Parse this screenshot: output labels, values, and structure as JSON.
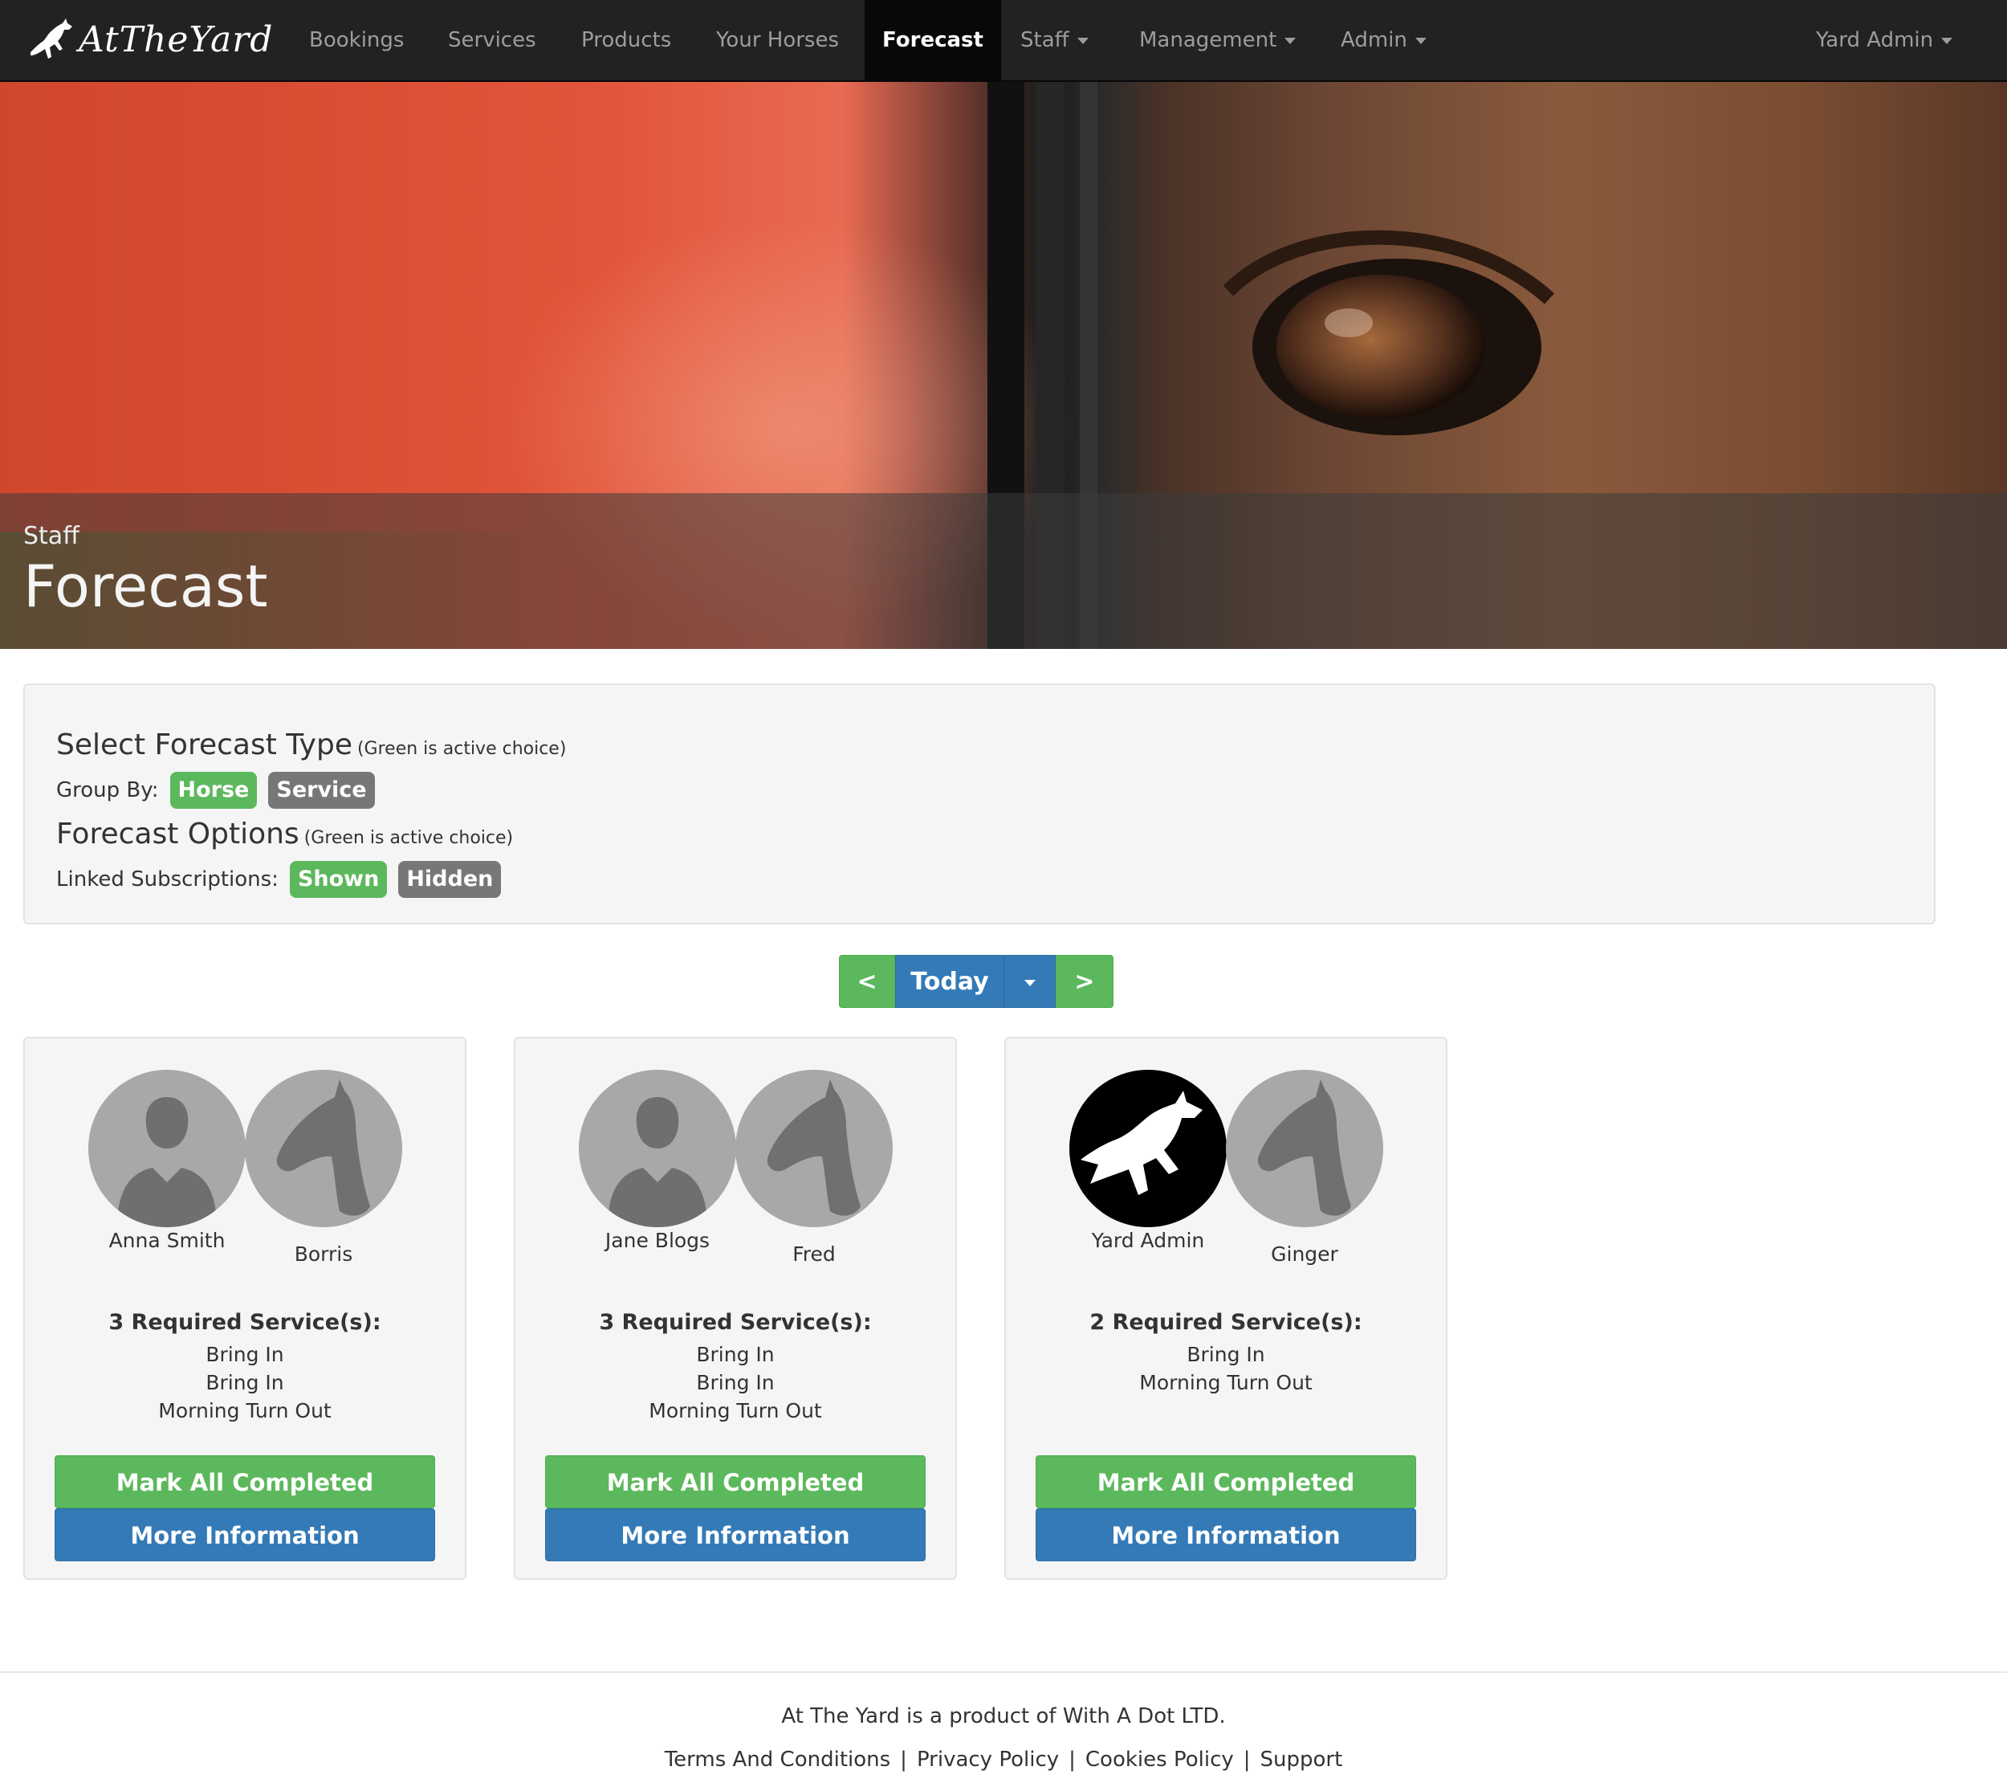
{
  "nav": {
    "brand": "AtTheYard",
    "items": [
      {
        "label": "Bookings"
      },
      {
        "label": "Services"
      },
      {
        "label": "Products"
      },
      {
        "label": "Your Horses"
      },
      {
        "label": "Forecast"
      },
      {
        "label": "Staff"
      },
      {
        "label": "Management"
      },
      {
        "label": "Admin"
      }
    ],
    "user": "Yard Admin"
  },
  "hero": {
    "subtitle": "Staff",
    "title": "Forecast"
  },
  "options": {
    "type_heading": "Select Forecast Type",
    "type_note": "(Green is active choice)",
    "group_by_label": "Group By:",
    "group_by": {
      "active": "Horse",
      "inactive": "Service"
    },
    "options_heading": "Forecast Options",
    "options_note": "(Green is active choice)",
    "linked_label": "Linked Subscriptions:",
    "linked": {
      "active": "Shown",
      "inactive": "Hidden"
    }
  },
  "date_nav": {
    "prev": "<",
    "today": "Today",
    "next": ">"
  },
  "cards": [
    {
      "person": "Anna Smith",
      "horse": "Borris",
      "required": "3 Required Service(s):",
      "services": [
        "Bring In",
        "Bring In",
        "Morning Turn Out"
      ],
      "complete_label": "Mark All Completed",
      "info_label": "More Information"
    },
    {
      "person": "Jane Blogs",
      "horse": "Fred",
      "required": "3 Required Service(s):",
      "services": [
        "Bring In",
        "Bring In",
        "Morning Turn Out"
      ],
      "complete_label": "Mark All Completed",
      "info_label": "More Information"
    },
    {
      "person": "Yard Admin",
      "horse": "Ginger",
      "required": "2 Required Service(s):",
      "services": [
        "Bring In",
        "Morning Turn Out"
      ],
      "complete_label": "Mark All Completed",
      "info_label": "More Information"
    }
  ],
  "footer": {
    "credit": "At The Yard is a product of With A Dot LTD.",
    "links": [
      "Terms And Conditions",
      "Privacy Policy",
      "Cookies Policy",
      "Support"
    ]
  },
  "colors": {
    "navbar": "#222222",
    "success": "#5cb85c",
    "primary": "#337ab7",
    "inactive_label": "#777777"
  },
  "icons": {
    "brand": "jumping-horse-logo",
    "person_avatar": "person-silhouette-icon",
    "horse_avatar": "horse-head-icon",
    "admin_avatar": "jumping-horse-icon",
    "dropdown": "caret-down-icon"
  }
}
